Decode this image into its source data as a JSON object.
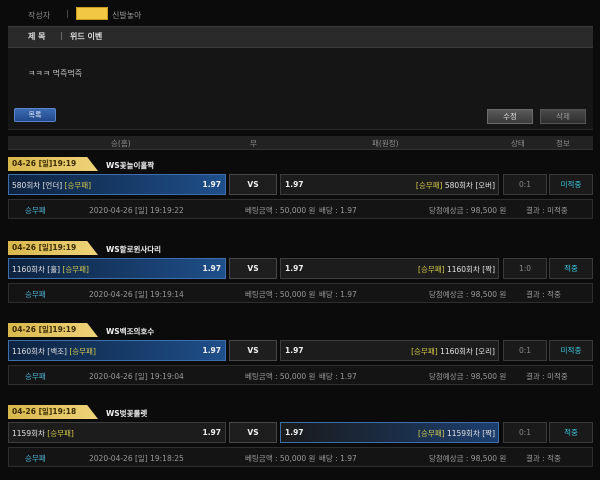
{
  "post": {
    "author_label": "작성자",
    "author_sep": "|",
    "author_name": "신발놓아",
    "title_label": "제 목",
    "title_sep": "|",
    "title": "위드 이벤",
    "body": "ㅋㅋㅋ 먹즉먹즉"
  },
  "buttons": {
    "list": "목록",
    "edit": "수정",
    "delete": "삭제"
  },
  "columns": {
    "home": "승(홈)",
    "draw": "무",
    "away": "패(원정)",
    "score": "상태",
    "info": "정보"
  },
  "bets": [
    {
      "date": "04-26 [일]19:19",
      "game": "WS꽃놀이홀짝",
      "home_name": "580회차 [언더]",
      "home_type": "[승무패]",
      "home_odds": "1.97",
      "vs": "VS",
      "away_odds": "1.97",
      "away_type": "[승무패]",
      "away_name": "580회차 [오버]",
      "score": "0:1",
      "status": "미적중",
      "selected": "home",
      "info_type": "승무패",
      "info_time": "2020-04-26 [일] 19:19:22",
      "info_amount": "베팅금액 : 50,000 원",
      "info_odds": "배당 : 1.97",
      "info_payout": "당첨예상금 : 98,500 원",
      "info_result": "결과 : 미적중"
    },
    {
      "date": "04-26 [일]19:19",
      "game": "WS할로윈사다리",
      "home_name": "1160회차 [홀]",
      "home_type": "[승무패]",
      "home_odds": "1.97",
      "vs": "VS",
      "away_odds": "1.97",
      "away_type": "[승무패]",
      "away_name": "1160회차 [짝]",
      "score": "1:0",
      "status": "적중",
      "selected": "home",
      "info_type": "승무패",
      "info_time": "2020-04-26 [일] 19:19:14",
      "info_amount": "베팅금액 : 50,000 원",
      "info_odds": "배당 : 1.97",
      "info_payout": "당첨예상금 : 98,500 원",
      "info_result": "결과 : 적중"
    },
    {
      "date": "04-26 [일]19:19",
      "game": "WS백조의호수",
      "home_name": "1160회차 [백조]",
      "home_type": "[승무패]",
      "home_odds": "1.97",
      "vs": "VS",
      "away_odds": "1.97",
      "away_type": "[승무패]",
      "away_name": "1160회차 [오리]",
      "score": "0:1",
      "status": "미적중",
      "selected": "home",
      "info_type": "승무패",
      "info_time": "2020-04-26 [일] 19:19:04",
      "info_amount": "베팅금액 : 50,000 원",
      "info_odds": "배당 : 1.97",
      "info_payout": "당첨예상금 : 98,500 원",
      "info_result": "결과 : 미적중"
    },
    {
      "date": "04-26 [일]19:18",
      "game": "WS벚꽃룰렛",
      "home_name": "1159회차",
      "home_type": "[승무패]",
      "home_odds": "1.97",
      "vs": "VS",
      "away_odds": "1.97",
      "away_type": "[승무패]",
      "away_name": "1159회차 [짝]",
      "score": "0:1",
      "status": "적중",
      "selected": "away",
      "info_type": "승무패",
      "info_time": "2020-04-26 [일] 19:18:25",
      "info_amount": "베팅금액 : 50,000 원",
      "info_odds": "배당 : 1.97",
      "info_payout": "당첨예상금 : 98,500 원",
      "info_result": "결과 : 적중"
    }
  ]
}
